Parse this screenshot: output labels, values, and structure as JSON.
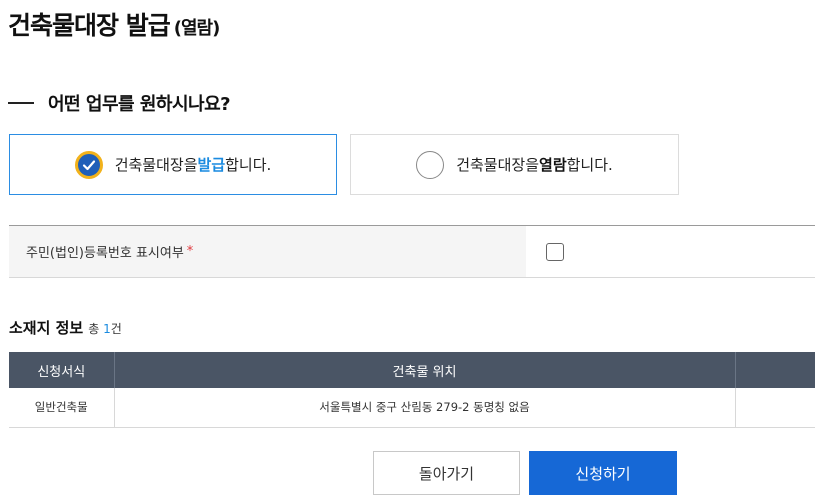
{
  "page": {
    "title": "건축물대장 발급",
    "title_suffix": "(열람)"
  },
  "question": {
    "text": "어떤 업무를 원하시나요?"
  },
  "options": [
    {
      "prefix": "건축물대장을 ",
      "keyword": "발급",
      "suffix": "합니다.",
      "selected": true
    },
    {
      "prefix": "건축물대장을 ",
      "keyword": "열람",
      "suffix": "합니다.",
      "selected": false
    }
  ],
  "registration": {
    "label": "주민(법인)등록번호 표시여부",
    "required_mark": "*",
    "checked": false
  },
  "location": {
    "title": "소재지 정보",
    "count_prefix": "총 ",
    "count": "1",
    "count_suffix": "건",
    "columns": [
      "신청서식",
      "건축물 위치",
      ""
    ],
    "rows": [
      [
        "일반건축물",
        "서울특별시 중구 산림동 279-2 동명칭 없음",
        ""
      ]
    ]
  },
  "buttons": {
    "back": "돌아가기",
    "apply": "신청하기"
  },
  "colors": {
    "accent": "#1a8be0",
    "primary_button": "#1668d6",
    "table_header": "#4a5565",
    "required": "#e0393e"
  }
}
